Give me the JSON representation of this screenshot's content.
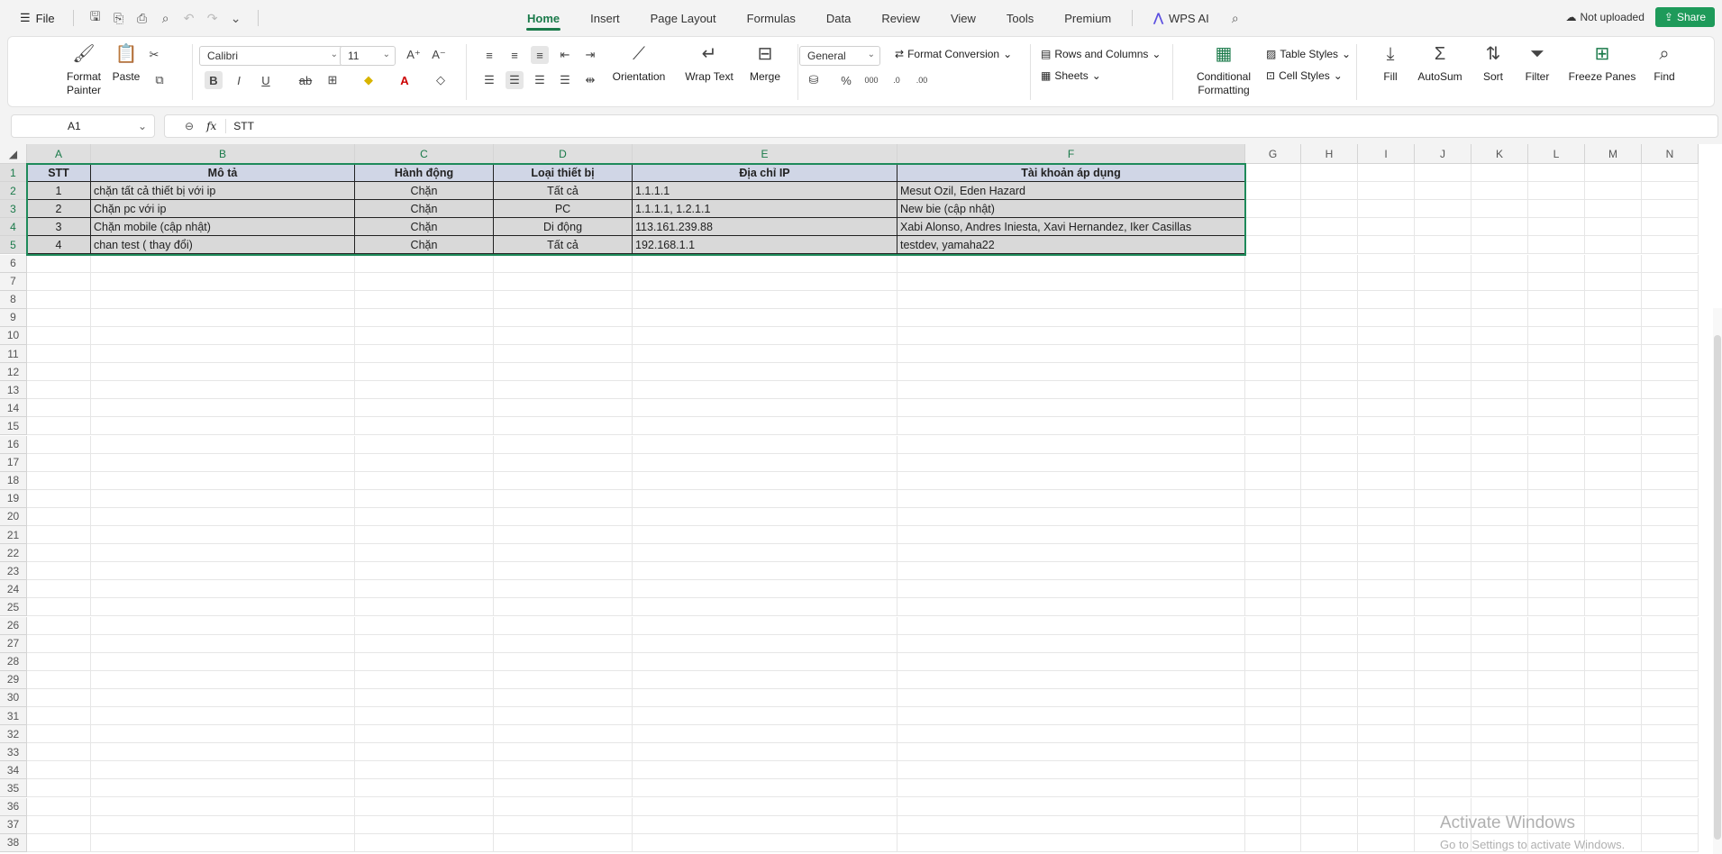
{
  "menubar": {
    "file_label": "File",
    "tabs": [
      "Home",
      "Insert",
      "Page Layout",
      "Formulas",
      "Data",
      "Review",
      "View",
      "Tools",
      "Premium"
    ],
    "wps_ai": "WPS AI",
    "not_uploaded": "Not uploaded",
    "share": "Share"
  },
  "ribbon": {
    "format_painter": "Format\nPainter",
    "paste": "Paste",
    "font_name": "Calibri",
    "font_size": "11",
    "number_format": "General",
    "format_conversion": "Format Conversion",
    "orientation": "Orientation",
    "wrap_text": "Wrap Text",
    "merge": "Merge",
    "rows_and_columns": "Rows and Columns",
    "sheets": "Sheets",
    "conditional_formatting": "Conditional\nFormatting",
    "table_styles": "Table Styles",
    "cell_styles": "Cell Styles",
    "fill": "Fill",
    "autosum": "AutoSum",
    "sort": "Sort",
    "filter": "Filter",
    "freeze_panes": "Freeze Panes",
    "find": "Find"
  },
  "formula_bar": {
    "name_box": "A1",
    "fx": "fx",
    "content": "STT"
  },
  "sheet": {
    "columns": [
      "A",
      "B",
      "C",
      "D",
      "E",
      "F",
      "G",
      "H",
      "I",
      "J",
      "K",
      "L",
      "M",
      "N"
    ],
    "headers": [
      "STT",
      "Mô tả",
      "Hành động",
      "Loại thiết bị",
      "Địa chỉ IP",
      "Tài khoản áp dụng"
    ],
    "rows": [
      [
        "1",
        "chặn tất cả thiết bị với ip",
        "Chặn",
        "Tất cả",
        "1.1.1.1",
        "Mesut Ozil, Eden Hazard"
      ],
      [
        "2",
        "Chặn pc với ip",
        "Chặn",
        "PC",
        "1.1.1.1, 1.2.1.1",
        "New bie (cập nhật)"
      ],
      [
        "3",
        "Chặn mobile (cập nhật)",
        "Chặn",
        "Di động",
        "113.161.239.88",
        "Xabi Alonso, Andres Iniesta, Xavi Hernandez, Iker Casillas"
      ],
      [
        "4",
        "chan test ( thay đổi)",
        "Chặn",
        "Tất cả",
        "192.168.1.1",
        "testdev, yamaha22"
      ]
    ],
    "row_count": 38
  },
  "watermark": {
    "line1": "Activate Windows",
    "line2": "Go to Settings to activate Windows."
  }
}
